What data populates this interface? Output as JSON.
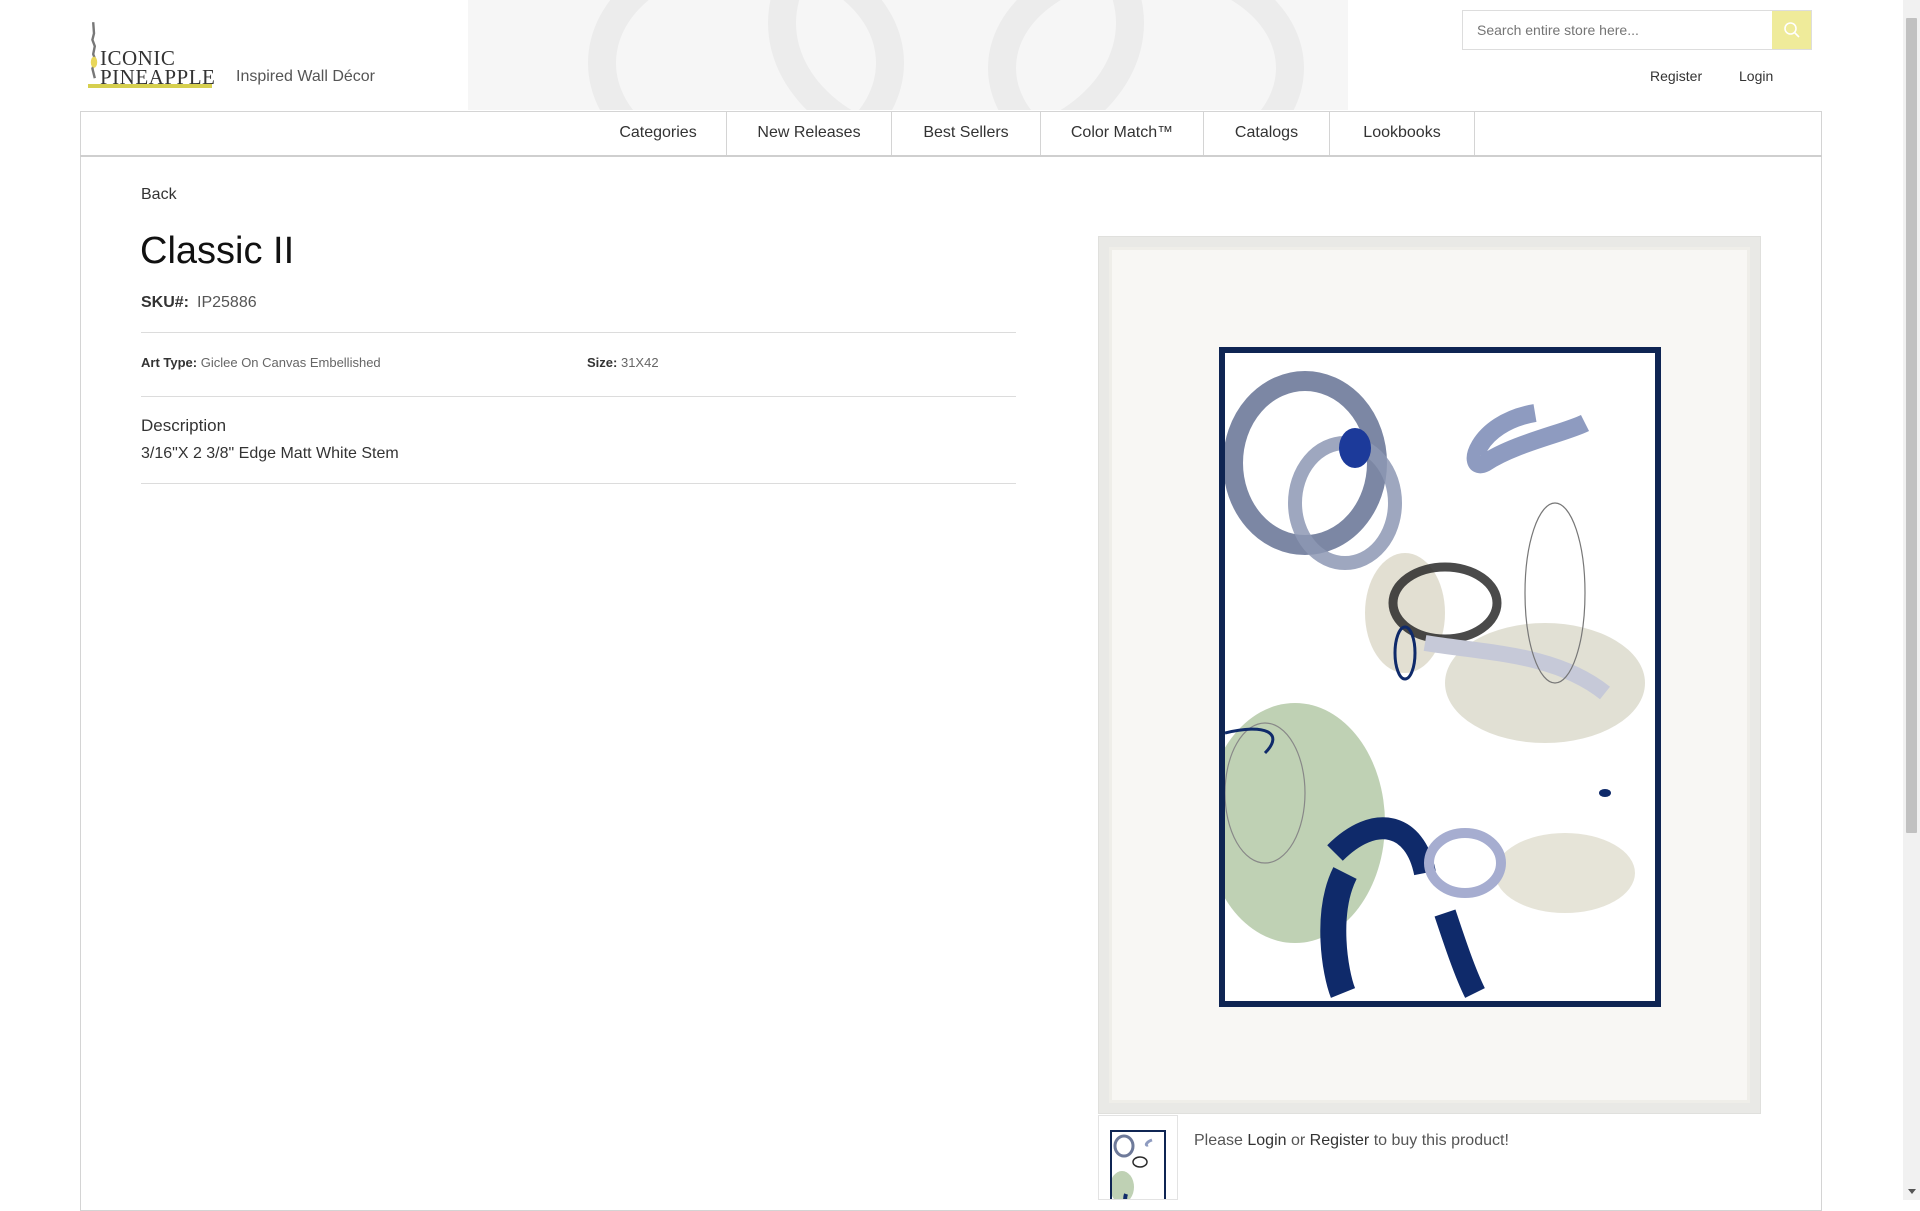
{
  "brand": {
    "logo_line1": "ICONIC",
    "logo_line2": "PINEAPPLE",
    "tagline": "Inspired Wall Décor",
    "accent_color": "#d6cf4e"
  },
  "search": {
    "placeholder": "Search entire store here...",
    "button_icon": "search-icon"
  },
  "account_links": {
    "register": "Register",
    "login": "Login"
  },
  "nav": {
    "items": [
      {
        "label": "Categories"
      },
      {
        "label": "New Releases"
      },
      {
        "label": "Best Sellers"
      },
      {
        "label": "Color Match™"
      },
      {
        "label": "Catalogs"
      },
      {
        "label": "Lookbooks"
      }
    ]
  },
  "product": {
    "back_label": "Back",
    "title": "Classic II",
    "sku_label": "SKU#:",
    "sku": "IP25886",
    "art_type_label": "Art Type:",
    "art_type": "Giclee On Canvas Embellished",
    "size_label": "Size:",
    "size": "31X42",
    "description_heading": "Description",
    "description": "3/16\"X 2 3/8\" Edge Matt White Stem",
    "image_alt": "Classic II framed abstract art",
    "thumbnail_alt": "Classic II thumbnail"
  },
  "purchase": {
    "prefix": "Please",
    "login": "Login",
    "middle": "or",
    "register": "Register",
    "suffix": "to buy this product!"
  }
}
